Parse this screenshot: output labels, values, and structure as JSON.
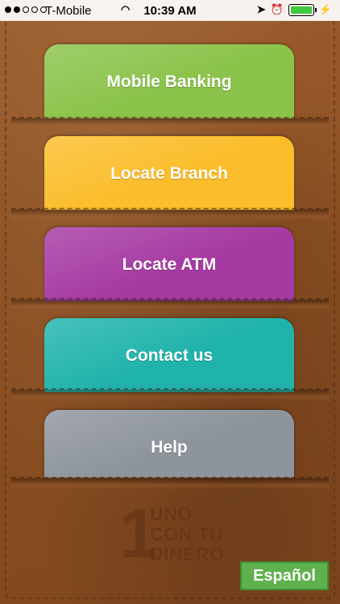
{
  "status_bar": {
    "carrier": "T-Mobile",
    "time": "10:39 AM",
    "icons": [
      "signal-dots-icon",
      "wifi-icon",
      "location-arrow-icon",
      "alarm-icon",
      "battery-icon"
    ]
  },
  "menu": {
    "cards": [
      {
        "label": "Mobile Banking",
        "color": "#8bc34a"
      },
      {
        "label": "Locate Branch",
        "color": "#fbbd2a"
      },
      {
        "label": "Locate ATM",
        "color": "#a63aa3"
      },
      {
        "label": "Contact us",
        "color": "#1fb3ab"
      },
      {
        "label": "Help",
        "color": "#8e949c"
      }
    ]
  },
  "logo": {
    "digit": "1",
    "words": [
      "UNO",
      "CON TU",
      "DINERO"
    ]
  },
  "language_button": {
    "label": "Español",
    "color": "#5fb14d"
  }
}
